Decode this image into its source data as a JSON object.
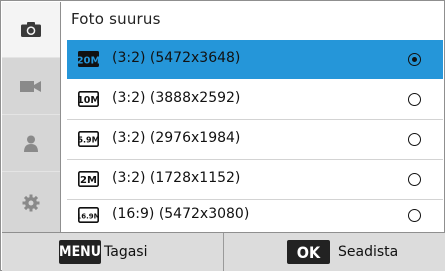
{
  "sidebar": {
    "tabs": [
      {
        "icon": "camera-icon",
        "active": true
      },
      {
        "icon": "video-camera-icon",
        "active": false
      },
      {
        "icon": "person-icon",
        "active": false
      },
      {
        "icon": "gear-icon",
        "active": false
      }
    ]
  },
  "panel": {
    "title": "Foto suurus",
    "options": [
      {
        "badge": "20M",
        "label": "(3:2) (5472x3648)",
        "selected": true
      },
      {
        "badge": "10M",
        "label": "(3:2) (3888x2592)",
        "selected": false
      },
      {
        "badge": "5.9M",
        "label": "(3:2) (2976x1984)",
        "selected": false
      },
      {
        "badge": "2M",
        "label": "(3:2) (1728x1152)",
        "selected": false
      },
      {
        "badge": "16.9M",
        "label": "(16:9) (5472x3080)",
        "selected": false
      }
    ]
  },
  "footer": {
    "menu_key": "MENU",
    "back_label": "Tagasi",
    "ok_key": "OK",
    "set_label": "Seadista"
  },
  "colors": {
    "selection": "#2596d9",
    "sidebar": "#d6d6d6",
    "footer": "#dcdcdc"
  }
}
